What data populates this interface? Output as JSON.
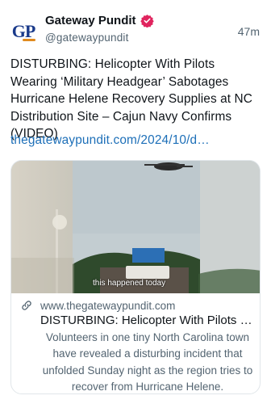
{
  "header": {
    "avatar_text": "GP",
    "display_name": "Gateway Pundit",
    "handle": "@gatewaypundit",
    "timestamp": "47m",
    "verified_icon": "verified-badge-icon",
    "verified_color": "#e0245e"
  },
  "post": {
    "text": "DISTURBING: Helicopter With Pilots Wearing ‘Military Headgear’ Sabotages Hurricane Helene Recovery Supplies at NC Distribution Site – Cajun Navy Confirms (VIDEO)",
    "link": "thegatewaypundit.com/2024/10/d…",
    "link_color": "#1d6fb8"
  },
  "card": {
    "media_caption": "this happened today",
    "link_icon": "link-icon",
    "domain": "www.thegatewaypundit.com",
    "title": "DISTURBING: Helicopter With Pilots W…",
    "description": "Volunteers in one tiny North Carolina town have revealed a disturbing incident that unfolded Sunday night as the region tries to recover from Hurricane Helene."
  }
}
